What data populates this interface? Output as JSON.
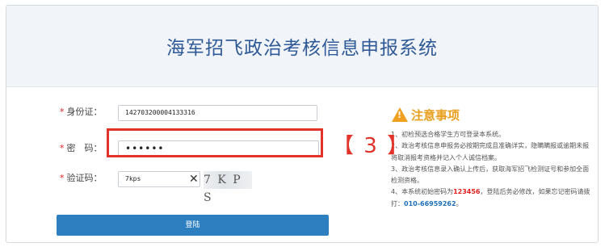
{
  "app": {
    "title": "海军招飞政治考核信息申报系统"
  },
  "form": {
    "id_label": "身份证：",
    "id_value": "142703200004133316",
    "password_label": "密　码：",
    "password_value": "••••••",
    "captcha_label": "验证码：",
    "captcha_value": "7kps",
    "captcha_image_text": "7 K P S",
    "clear_glyph": "✕",
    "required_mark": "*",
    "login_label": "登陆"
  },
  "annotation": {
    "step": "【 3 】"
  },
  "notice": {
    "title": "注意事项",
    "items": [
      "1、初检预选合格学生方可登录本系统。",
      "2、政治考核信息申报务必按期完成且准确详实，隐瞒瞒报或逾期未报将取消报考资格并记入个人诚信档案。",
      "3、政治考核信息录入确认上传后，获取海军招飞检测证号和参加全面检测资格。"
    ],
    "item4_prefix": "4、本系统初始密码为",
    "item4_password": "123456",
    "item4_middle": "，登陆后务必修改，如果忘记密码请拨打：",
    "item4_phone": "010-66959262",
    "item4_suffix": "。"
  }
}
